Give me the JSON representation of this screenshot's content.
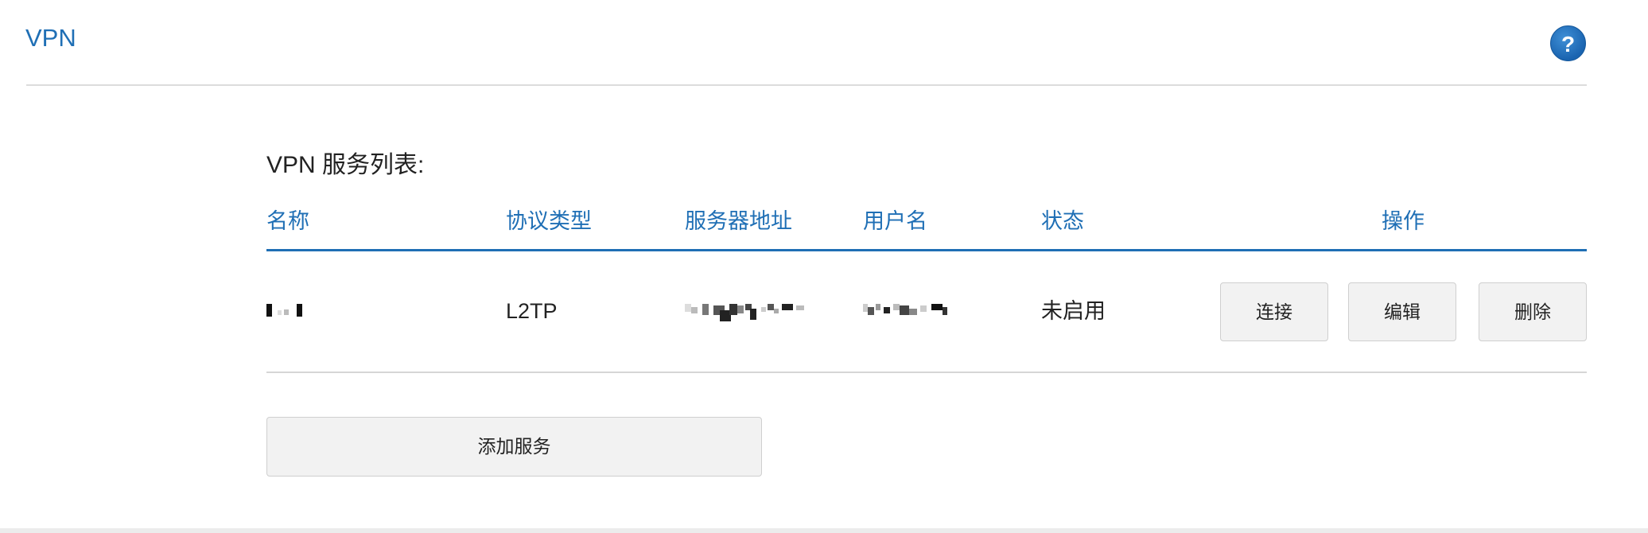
{
  "header": {
    "title": "VPN",
    "help_label": "?"
  },
  "vpn_list": {
    "label": "VPN 服务列表:",
    "columns": [
      "名称",
      "协议类型",
      "服务器地址",
      "用户名",
      "状态",
      "操作"
    ],
    "rows": [
      {
        "name": "",
        "protocol": "L2TP",
        "server": "",
        "username": "",
        "status": "未启用",
        "actions": {
          "connect": "连接",
          "edit": "编辑",
          "delete": "删除"
        }
      }
    ]
  },
  "add_service_label": "添加服务",
  "colors": {
    "accent": "#1f6fb5",
    "button_bg": "#f2f2f2"
  }
}
